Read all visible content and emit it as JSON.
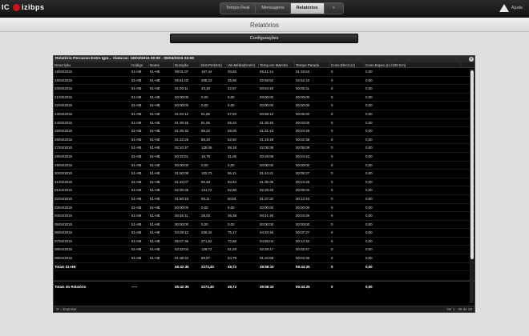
{
  "app": {
    "logo_text": "IC",
    "brand": "izibps",
    "help_label": "Ajuda"
  },
  "nav": {
    "tabs": [
      "Tempo Real",
      "Mensagens",
      "Relatórios",
      "»"
    ]
  },
  "page": {
    "title": "Relatórios",
    "config_label": "Configurações"
  },
  "report": {
    "title": "Relatório Percurso Entre Igm... Viaturas: 18/03/2015 00:00 - 09/04/2015 23:59",
    "columns": [
      "Descrição",
      "Código",
      "Nome",
      "Duração",
      "Dist.Per(Km)",
      "Vel.Média(Km/H)",
      "Temp.em Marcha",
      "Tempo Parado",
      "Cons.Efect.(Lt)",
      "Cons.Espec.(Lt./100 Km)"
    ],
    "rows": [
      [
        "18/03/2015",
        "51-HB",
        "51-HB",
        "08:01:07",
        "167,44",
        "20,83",
        "06:41:14",
        "01:19:53",
        "0",
        "0,00"
      ],
      [
        "19/03/2015",
        "51-HB",
        "51-HB",
        "05:51:02",
        "208,23",
        "35,55",
        "02:58:52",
        "02:52:10",
        "0",
        "0,00"
      ],
      [
        "20/03/2015",
        "51-HB",
        "51-HB",
        "01:00:11",
        "43,30",
        "42,87",
        "00:54:40",
        "00:05:31",
        "0",
        "0,00"
      ],
      [
        "21/03/2015",
        "51-HB",
        "51-HB",
        "00:00:00",
        "0,00",
        "0,00",
        "00:00:00",
        "00:00:00",
        "0",
        "0,00"
      ],
      [
        "22/03/2015",
        "51-HB",
        "51-HB",
        "00:00:00",
        "0,00",
        "0,00",
        "00:00:00",
        "00:00:00",
        "0",
        "0,00"
      ],
      [
        "23/03/2015",
        "51-HB",
        "51-HB",
        "01:04:12",
        "61,85",
        "57,94",
        "00:58:12",
        "00:06:00",
        "0",
        "0,00"
      ],
      [
        "24/03/2015",
        "51-HB",
        "51-HB",
        "01:39:45",
        "91,65",
        "55,34",
        "01:36:40",
        "00:03:05",
        "0",
        "0,00"
      ],
      [
        "25/03/2015",
        "51-HB",
        "51-HB",
        "01:36:32",
        "95,22",
        "59,05",
        "01:31:43",
        "00:04:49",
        "0",
        "0,00"
      ],
      [
        "26/03/2015",
        "51-HB",
        "51-HB",
        "01:22:26",
        "88,20",
        "62,60",
        "01:19:48",
        "00:02:38",
        "0",
        "0,00"
      ],
      [
        "27/03/2015",
        "51-HB",
        "51-HB",
        "02:10:47",
        "129,08",
        "59,18",
        "02:05:38",
        "00:05:09",
        "0",
        "0,00"
      ],
      [
        "28/03/2015",
        "51-HB",
        "51-HB",
        "00:32:51",
        "16,75",
        "31,05",
        "00:28:09",
        "00:04:42",
        "0",
        "0,00"
      ],
      [
        "29/03/2015",
        "51-HB",
        "51-HB",
        "00:00:00",
        "0,00",
        "0,00",
        "00:00:00",
        "00:00:00",
        "0",
        "0,00"
      ],
      [
        "30/03/2015",
        "51-HB",
        "51-HB",
        "01:50:08",
        "102,73",
        "56,11",
        "01:44:41",
        "00:05:27",
        "0",
        "0,00"
      ],
      [
        "31/03/2015",
        "51-HB",
        "51-HB",
        "01:40:07",
        "90,48",
        "53,94",
        "01:35:39",
        "00:04:28",
        "0",
        "0,00"
      ],
      [
        "01/04/2015",
        "51-HB",
        "51-HB",
        "02:30:35",
        "131,72",
        "52,80",
        "02:25:33",
        "00:05:02",
        "0",
        "0,00"
      ],
      [
        "02/04/2015",
        "51-HB",
        "51-HB",
        "01:50:15",
        "93,11",
        "50,81",
        "01:37:32",
        "00:12:43",
        "0",
        "0,00"
      ],
      [
        "03/04/2015",
        "51-HB",
        "51-HB",
        "00:00:00",
        "0,00",
        "0,00",
        "00:00:00",
        "00:00:00",
        "0",
        "0,00"
      ],
      [
        "04/04/2015",
        "51-HB",
        "51-HB",
        "00:46:11",
        "28,03",
        "36,38",
        "00:41:45",
        "00:04:26",
        "0",
        "0,00"
      ],
      [
        "05/04/2015",
        "51-HB",
        "51-HB",
        "00:00:00",
        "0,00",
        "0,00",
        "00:00:00",
        "00:00:00",
        "0",
        "0,00"
      ],
      [
        "06/04/2015",
        "51-HB",
        "51-HB",
        "04:28:12",
        "336,42",
        "75,17",
        "04:20:45",
        "00:07:27",
        "0",
        "0,00"
      ],
      [
        "07/04/2015",
        "51-HB",
        "51-HB",
        "05:07:36",
        "371,62",
        "72,56",
        "04:55:04",
        "00:12:32",
        "0",
        "0,00"
      ],
      [
        "08/04/2015",
        "51-HB",
        "51-HB",
        "02:32:04",
        "129,72",
        "51,29",
        "02:29:17",
        "00:02:47",
        "0",
        "0,00"
      ],
      [
        "09/04/2015",
        "51-HB",
        "51-HB",
        "01:38:34",
        "89,87",
        "54,79",
        "01:34:58",
        "00:03:36",
        "0",
        "0,00"
      ]
    ],
    "subtotal": [
      "Totais 51-HB",
      "",
      "",
      "45:42:35",
      "2273,40",
      "49,73",
      "39:58:10",
      "05:44:25",
      "0",
      "0,00"
    ],
    "grand_total": [
      "Totais do Relatório",
      "-----",
      "",
      "45:42:35",
      "2273,40",
      "49,73",
      "39:58:10",
      "05:44:25",
      "0",
      "0,00"
    ],
    "export_label": "Exportar",
    "pagination": "Ver 1 - 28 de 28"
  }
}
